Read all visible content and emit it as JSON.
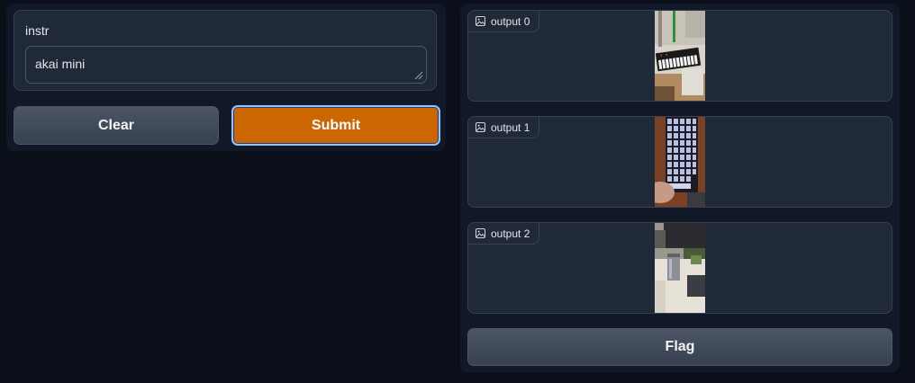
{
  "input": {
    "label": "instr",
    "value": "akai mini"
  },
  "buttons": {
    "clear": "Clear",
    "submit": "Submit",
    "flag": "Flag"
  },
  "outputs": [
    {
      "label": "output 0",
      "icon": "image-icon"
    },
    {
      "label": "output 1",
      "icon": "image-icon"
    },
    {
      "label": "output 2",
      "icon": "image-icon"
    }
  ],
  "colors": {
    "background": "#0b0f19",
    "panel": "#111827",
    "submit": "#cc6600",
    "secondary_button": "#4b5563"
  }
}
